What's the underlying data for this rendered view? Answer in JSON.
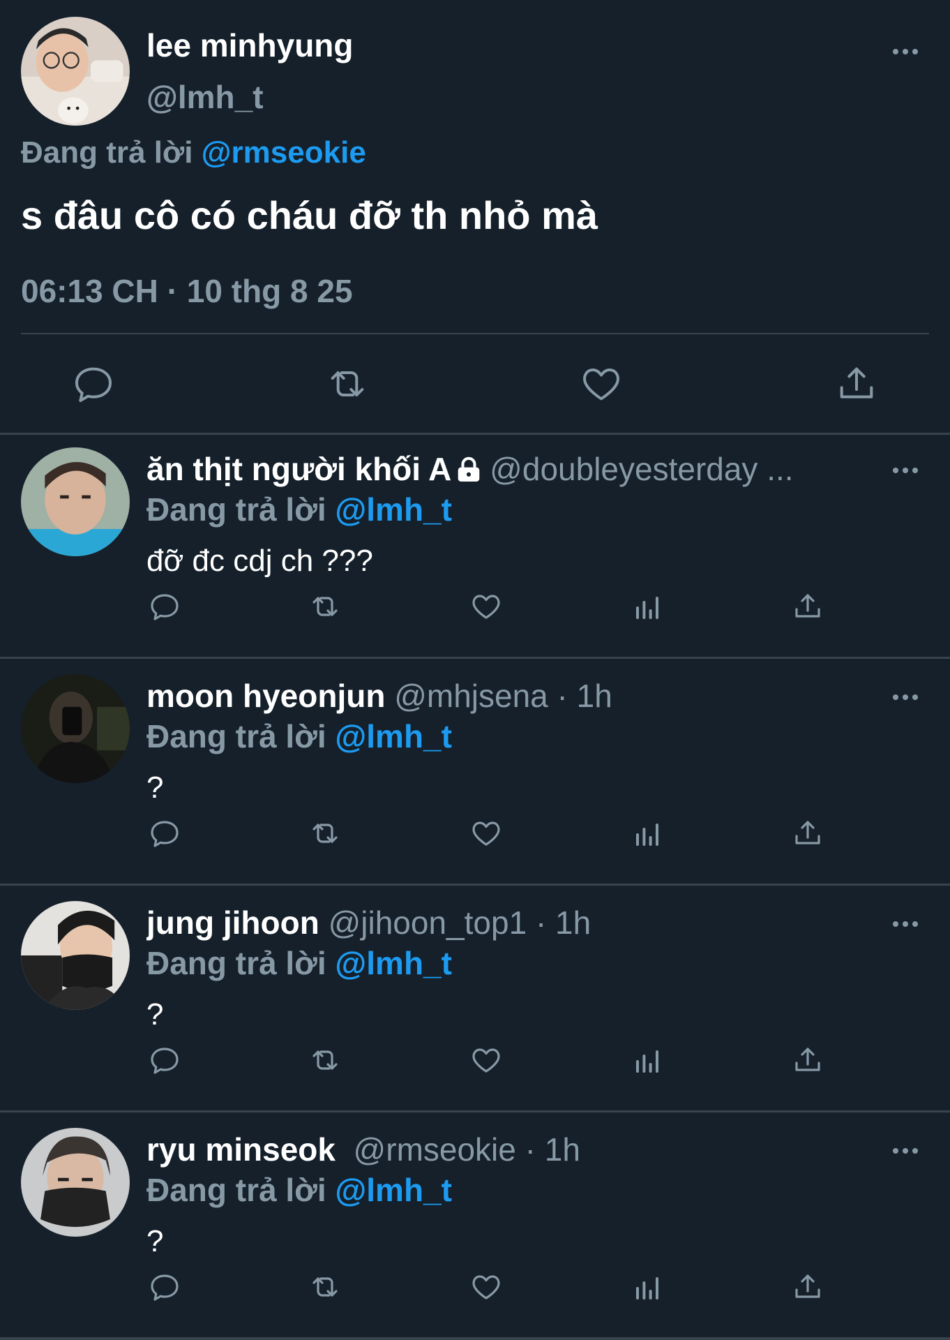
{
  "main_tweet": {
    "display_name": "lee minhyung",
    "handle": "@lmh_t",
    "replying_prefix": "Đang trả lời ",
    "replying_to": "@rmseokie",
    "text": "s đâu cô có cháu đỡ th nhỏ mà",
    "timestamp": "06:13 CH · 10 thg 8 25",
    "actions": [
      "reply-icon",
      "retweet-icon",
      "like-icon",
      "share-icon"
    ]
  },
  "replies": [
    {
      "display_name": "ăn thịt người khối A",
      "locked": true,
      "meta": " @doubleyesterday ...",
      "replying_prefix": "Đang trả lời ",
      "replying_to": "@lmh_t",
      "text": "đỡ đc cdj ch ???"
    },
    {
      "display_name": "moon hyeonjun",
      "meta": " @mhjsena · 1h",
      "replying_prefix": "Đang trả lời ",
      "replying_to": "@lmh_t",
      "text": "?"
    },
    {
      "display_name": "jung jihoon",
      "meta": " @jihoon_top1 · 1h",
      "replying_prefix": "Đang trả lời ",
      "replying_to": "@lmh_t",
      "text": "?"
    },
    {
      "display_name": "ryu minseok",
      "meta": "  @rmseokie · 1h",
      "replying_prefix": "Đang trả lời ",
      "replying_to": "@lmh_t",
      "text": "?"
    }
  ],
  "reply_actions": [
    "reply-icon",
    "retweet-icon",
    "like-icon",
    "analytics-icon",
    "share-icon"
  ],
  "colors": {
    "background": "#15202b",
    "divider": "#38444d",
    "secondary_text": "#8899a6",
    "accent": "#1d9bf0"
  }
}
